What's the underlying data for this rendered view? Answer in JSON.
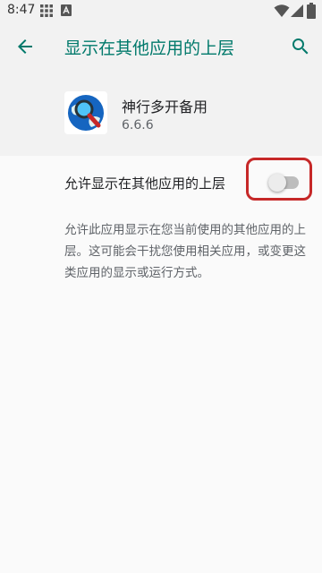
{
  "status_bar": {
    "time": "8:47",
    "icons": [
      "grid-icon",
      "a-notification-icon",
      "wifi-icon",
      "signal-icon",
      "battery-icon"
    ]
  },
  "app_bar": {
    "title": "显示在其他应用的上层",
    "back_icon": "arrow-left-icon",
    "search_icon": "search-icon",
    "accent_color": "#00796b"
  },
  "app_info": {
    "name": "神行多开备用",
    "version": "6.6.6",
    "icon": "globe-magnifier-icon"
  },
  "setting": {
    "label": "允许显示在其他应用的上层",
    "enabled": false,
    "highlight_color": "#c62828"
  },
  "description": "允许此应用显示在您当前使用的其他应用的上层。这可能会干扰您使用相关应用，或变更这类应用的显示或运行方式。"
}
